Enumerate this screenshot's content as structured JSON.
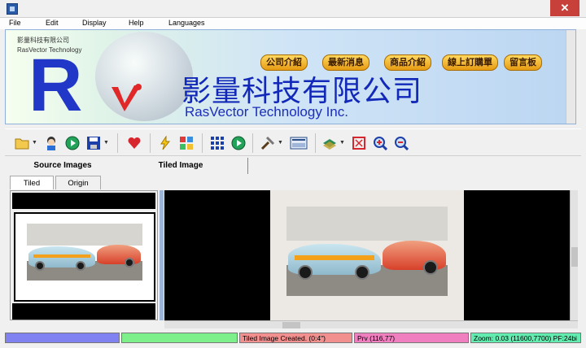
{
  "menu": [
    "File",
    "Edit",
    "Display",
    "Help",
    "Languages"
  ],
  "banner": {
    "small_cn": "影量科技有限公司",
    "small_en": "RasVector Technology",
    "logo_text": "R",
    "title_cn": "影量科技有限公司",
    "title_en": "RasVector Technology Inc.",
    "buttons": [
      "公司介紹",
      "最新消息",
      "商品介紹",
      "線上訂購單",
      "留言板"
    ]
  },
  "tabs": {
    "top": [
      "Source Images",
      "Tiled Image"
    ],
    "sub": [
      "Tiled",
      "Origin"
    ]
  },
  "status": {
    "cells": [
      {
        "text": "",
        "color": "#7f82f0"
      },
      {
        "text": "",
        "color": "#7ef08b"
      },
      {
        "text": "Tiled Image Created. (0:4\")",
        "color": "#f29090"
      },
      {
        "text": "Prv (116,77)",
        "color": "#f07fc0"
      },
      {
        "text": "Zoom: 0.03  (11600,7700) PF:24bi",
        "color": "#62ecb0"
      }
    ]
  },
  "colors": {
    "banner_blue": "#1b2dbb",
    "logo_red": "#e02828",
    "button_gold": "#f0b030"
  },
  "icons": [
    "folder-open-icon",
    "person-icon",
    "play-icon",
    "save-icon",
    "heart-icon",
    "lightning-icon",
    "puzzle-icon",
    "grid-icon",
    "play-icon",
    "tools-icon",
    "film-icon",
    "layers-icon",
    "fit-icon",
    "zoom-in-icon",
    "zoom-out-icon"
  ]
}
